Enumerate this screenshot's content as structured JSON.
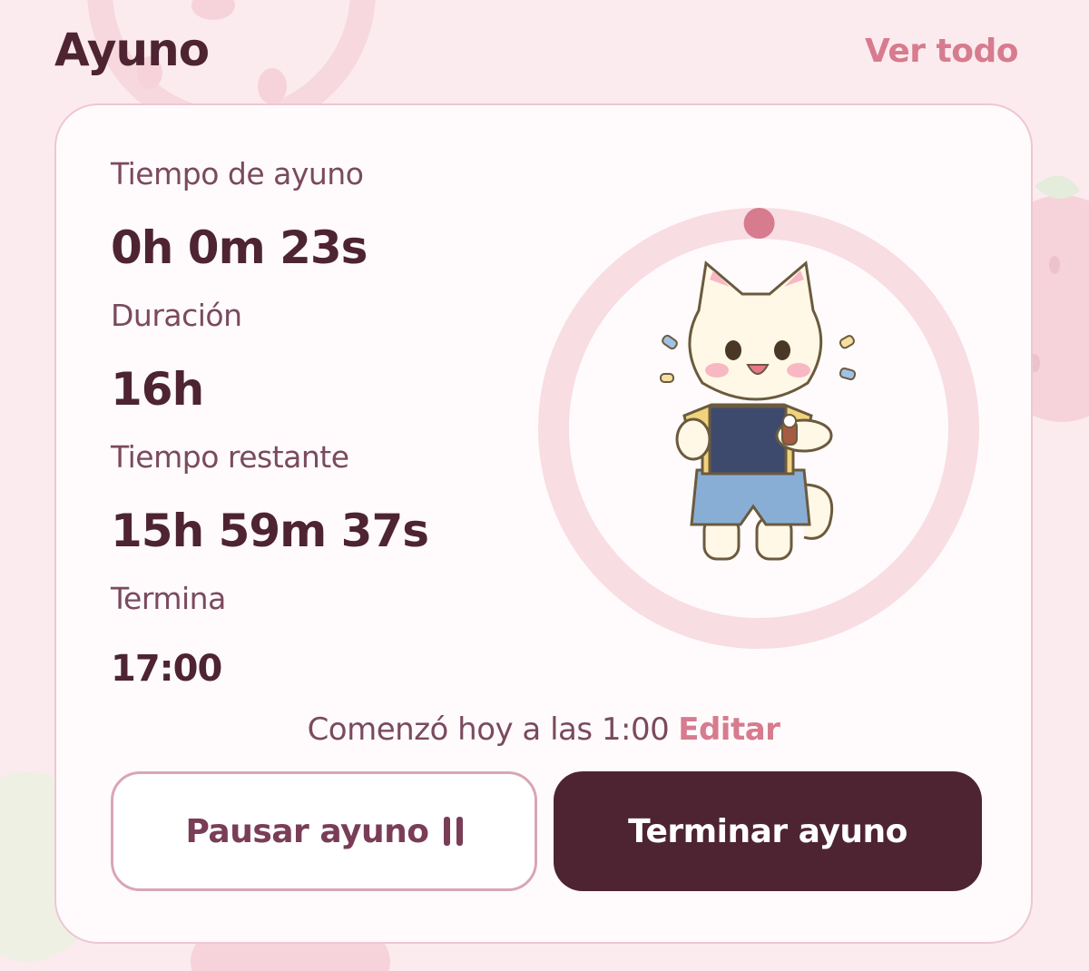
{
  "header": {
    "title": "Ayuno",
    "see_all": "Ver todo"
  },
  "fasting": {
    "elapsed_label": "Tiempo de ayuno",
    "elapsed_value": "0h 0m 23s",
    "duration_label": "Duración",
    "duration_value": "16h",
    "remaining_label": "Tiempo restante",
    "remaining_value": "15h 59m 37s",
    "ends_label": "Termina",
    "ends_value": "17:00",
    "progress_fraction": 0.0004,
    "started_text": "Comenzó hoy a las 1:00",
    "edit_label": "Editar"
  },
  "buttons": {
    "pause_label": "Pausar ayuno",
    "end_label": "Terminar ayuno"
  },
  "mascot": "cat-mascot-checking-watch",
  "icons": {
    "pause": "pause-icon",
    "progress_marker": "progress-marker-dot"
  },
  "colors": {
    "background": "#fcebee",
    "card": "#fffbfc",
    "primary_dark": "#4e2432",
    "accent_pink": "#d77b8f",
    "ring_track": "#f8dde3",
    "pause_border": "#d9a6b3"
  }
}
